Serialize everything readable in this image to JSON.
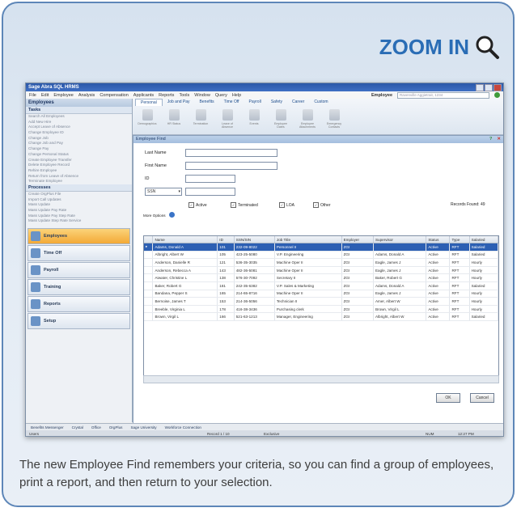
{
  "zoom": {
    "label": "ZOOM IN",
    "icon": "magnifier-icon"
  },
  "caption": "The new Employee Find remembers your criteria, so you can find a group of employees, print a report, and then return to your selection.",
  "app": {
    "title": "Sage Abra SQL HRMS",
    "menus": [
      "File",
      "Edit",
      "Employee",
      "Analysis",
      "Compensation",
      "Applicants",
      "Reports",
      "Tools",
      "Window",
      "Query",
      "Help"
    ],
    "employee_label": "Employee",
    "employee_value": "Ravenville Aggietrait, 1234"
  },
  "leftpane": {
    "header": "Employees",
    "tasks_label": "Tasks",
    "tasks": [
      "Search All Employees",
      "Add New Hire",
      "Accept Leave of Absence",
      "Change Employee ID",
      "Change Job",
      "Change Job and Pay",
      "Change Pay",
      "Change Personal Status",
      "Create Employee Transfer",
      "Delete Employee Record",
      "Rehire Employee",
      "Return from Leave of Absence",
      "Terminate Employee"
    ],
    "processes_label": "Processes",
    "processes": [
      "Create OrgPlus File",
      "Import Call Updates",
      "Mass Update",
      "Mass Update Pay Rate",
      "Mass Update Pay Step Rate",
      "Mass Update Step Rate Service"
    ],
    "nav": [
      "Employees",
      "Time Off",
      "Payroll",
      "Training",
      "Reports",
      "Setup"
    ]
  },
  "ribbon": {
    "tabs": [
      "Personal",
      "Job and Pay",
      "Benefits",
      "Time Off",
      "Payroll",
      "Safety",
      "Career",
      "Custom"
    ],
    "tools": [
      "Demographics",
      "HR Status",
      "Termination",
      "Leave of Absence",
      "Events",
      "Employee Dates",
      "Employee Attachments",
      "Emergency Contacts"
    ]
  },
  "find": {
    "title": "Employee Find",
    "last_name": "Last Name",
    "first_name": "First Name",
    "id": "ID",
    "ssn": "SSN",
    "active": "Active",
    "terminated": "Terminated",
    "loa": "LOA",
    "other": "Other",
    "records_found": "Records Found: 49",
    "more_options": "More Options",
    "ok": "OK",
    "cancel": "Cancel",
    "columns": [
      "",
      "Name",
      "ID",
      "SSN/SIN",
      "Job Title",
      "Employer",
      "Supervisor",
      "Status",
      "Type",
      "Salaried"
    ],
    "rows": [
      [
        "▸",
        "Adams, Donald A",
        "101",
        "232-09-8022",
        "Personnel II",
        "ZGI",
        "",
        "Active",
        "RFT",
        "Salaried"
      ],
      [
        "",
        "Albright, Albert W",
        "105",
        "423-25-5080",
        "V.P. Engineering",
        "ZGI",
        "Adams, Donald A",
        "Active",
        "RFT",
        "Salaried"
      ],
      [
        "",
        "Anderson, Danielle R",
        "121",
        "536-35-3035",
        "Machine Oper II",
        "ZGI",
        "Eagle, James J",
        "Active",
        "RFT",
        "Hourly"
      ],
      [
        "",
        "Anderson, Rebecca A",
        "143",
        "482-36-5081",
        "Machine Oper II",
        "ZGI",
        "Eagle, James J",
        "Active",
        "RFT",
        "Hourly"
      ],
      [
        "",
        "Atwater, Christine L",
        "138",
        "576-30-7092",
        "Secretary II",
        "ZGI",
        "Baker, Robert G",
        "Active",
        "RFT",
        "Hourly"
      ],
      [
        "",
        "Baker, Robert G",
        "181",
        "242-35-6382",
        "V.P. Sales & Marketing",
        "ZGI",
        "Adams, Donald A",
        "Active",
        "RFT",
        "Salaried"
      ],
      [
        "",
        "Bandana, Pepper S",
        "165",
        "214-65-8716",
        "Machine Oper II",
        "ZGI",
        "Eagle, James J",
        "Active",
        "RFT",
        "Hourly"
      ],
      [
        "",
        "Bernoise, James T",
        "153",
        "214-36-5056",
        "Technician II",
        "ZGI",
        "Amer, Albert W",
        "Active",
        "RFT",
        "Hourly"
      ],
      [
        "",
        "Breeble, Virginia L",
        "178",
        "416-38-3436",
        "Purchasing clerk",
        "ZGI",
        "Brown, Virgil L",
        "Active",
        "RFT",
        "Hourly"
      ],
      [
        "",
        "Brown, Virgil L",
        "166",
        "521-63-1213",
        "Manager, Engineering",
        "ZGI",
        "Albright, Albert W",
        "Active",
        "RFT",
        "Salaried"
      ]
    ]
  },
  "status": {
    "links": [
      "Benefits Messenger",
      "Crystal",
      "Office",
      "OrgPlus",
      "Sage University",
      "Workforce Connection"
    ],
    "left": "Users",
    "record": "Record 1 / 10",
    "mode": "Exclusive",
    "num": "NUM",
    "time": "12:27 PM"
  }
}
